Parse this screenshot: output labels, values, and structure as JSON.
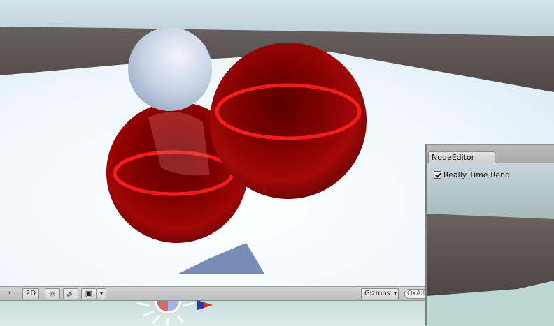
{
  "scene_toolbar": {
    "dropdown_glyph": "▾",
    "mode_2d": "2D",
    "lighting_icon": "☼",
    "audio_icon": "🔊",
    "effects_icon": "▣",
    "effects_dropdown": "▾",
    "gizmos_label": "Gizmos",
    "gizmos_dropdown": "▾",
    "search_value": "Q▾All"
  },
  "node_editor": {
    "tab_title": "NodeEditor",
    "toggle_label": "Really Time Rend",
    "toggle_checked": true
  },
  "colors": {
    "sphere_red": "#b00000",
    "sphere_white": "#c8d4e6",
    "ground": "#eef6fb",
    "horizon": "#5a4f4c"
  }
}
